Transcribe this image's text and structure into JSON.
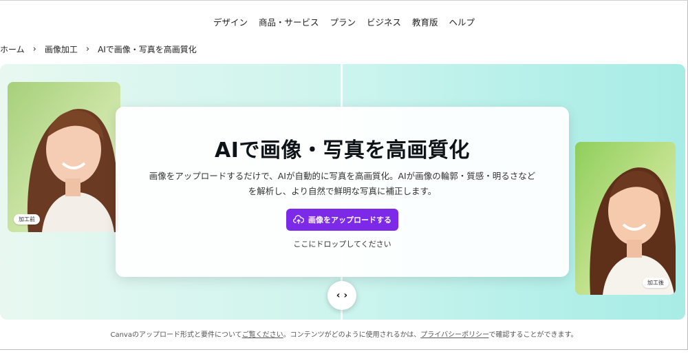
{
  "nav": {
    "items": [
      "デザイン",
      "商品・サービス",
      "プラン",
      "ビジネス",
      "教育版",
      "ヘルプ"
    ]
  },
  "breadcrumb": {
    "items": [
      "ホーム",
      "画像加工",
      "AIで画像・写真を高画質化"
    ],
    "separator": "›"
  },
  "hero": {
    "title": "AIで画像・写真を高画質化",
    "description_line1": "画像をアップロードするだけで、AIが自動的に写真を高画質化。AIが画像の輪郭・質感・明るさなど",
    "description_line2": "を解析し、より自然で鮮明な写真に補正します。",
    "upload_button": "画像をアップロードする",
    "drop_text": "ここにドロップしてください",
    "before_label": "加工前",
    "after_label": "加工後",
    "compare_handle": "‹ ›",
    "accent_color": "#7d2ae8"
  },
  "footer": {
    "text1": "Canvaのアップロード形式と要件について",
    "link1": "ご覧ください",
    "text2": "。コンテンツがどのように使用されるかは、",
    "link2": "プライバシーポリシー",
    "text3": "で確認することができます。"
  }
}
